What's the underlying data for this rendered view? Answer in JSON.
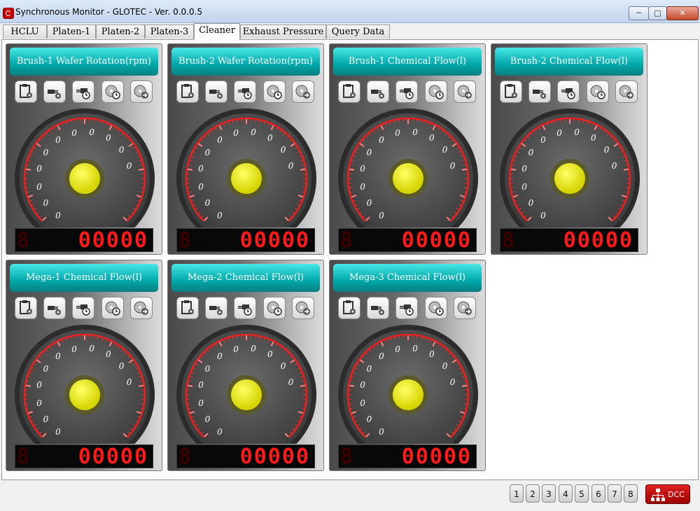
{
  "window": {
    "title": "Synchronous Monitor - GLOTEC - Ver. 0.0.0.5",
    "min_glyph": "─",
    "max_glyph": "□",
    "close_glyph": "✕"
  },
  "tabs": [
    {
      "label": "HCLU",
      "active": false
    },
    {
      "label": "Platen-1",
      "active": false
    },
    {
      "label": "Platen-2",
      "active": false
    },
    {
      "label": "Platen-3",
      "active": false
    },
    {
      "label": "Cleaner",
      "active": true
    },
    {
      "label": "Exhaust Pressure",
      "active": false
    },
    {
      "label": "Query Data",
      "active": false
    }
  ],
  "panels": [
    {
      "title": "Brush-1 Wafer Rotation(rpm)",
      "value": "00000",
      "ghost": "8",
      "scale_labels": [
        "0",
        "0",
        "0",
        "0",
        "0",
        "0",
        "0",
        "0",
        "0",
        "0",
        "0"
      ]
    },
    {
      "title": "Brush-2 Wafer Rotation(rpm)",
      "value": "00000",
      "ghost": "8",
      "scale_labels": [
        "0",
        "0",
        "0",
        "0",
        "0",
        "0",
        "0",
        "0",
        "0",
        "0",
        "0"
      ]
    },
    {
      "title": "Brush-1 Chemical Flow(l)",
      "value": "00000",
      "ghost": "8",
      "scale_labels": [
        "0",
        "0",
        "0",
        "0",
        "0",
        "0",
        "0",
        "0",
        "0",
        "0",
        "0"
      ]
    },
    {
      "title": "Brush-2 Chemical Flow(l)",
      "value": "00000",
      "ghost": "8",
      "scale_labels": [
        "0",
        "0",
        "0",
        "0",
        "0",
        "0",
        "0",
        "0",
        "0",
        "0",
        "0"
      ]
    },
    {
      "title": "Mega-1 Chemical Flow(l)",
      "value": "00000",
      "ghost": "8",
      "scale_labels": [
        "0",
        "0",
        "0",
        "0",
        "0",
        "0",
        "0",
        "0",
        "0",
        "0",
        "0"
      ]
    },
    {
      "title": "Mega-2 Chemical Flow(l)",
      "value": "00000",
      "ghost": "8",
      "scale_labels": [
        "0",
        "0",
        "0",
        "0",
        "0",
        "0",
        "0",
        "0",
        "0",
        "0",
        "0"
      ]
    },
    {
      "title": "Mega-3 Chemical Flow(l)",
      "value": "00000",
      "ghost": "8",
      "scale_labels": [
        "0",
        "0",
        "0",
        "0",
        "0",
        "0",
        "0",
        "0",
        "0",
        "0",
        "0"
      ]
    }
  ],
  "tool_icons": [
    "clipboard-settings-icon",
    "plug-settings-icon",
    "plug-clock-icon",
    "disk-clock-icon",
    "disk-arrow-icon"
  ],
  "status": {
    "pages": [
      "1",
      "2",
      "3",
      "4",
      "5",
      "6",
      "7",
      "8"
    ],
    "dcc_label": "DCC"
  },
  "colors": {
    "title_teal": "#00a8aa",
    "led_red": "#ff1a1a",
    "gauge_center": "#e6e600",
    "dcc_red": "#cc0000"
  }
}
